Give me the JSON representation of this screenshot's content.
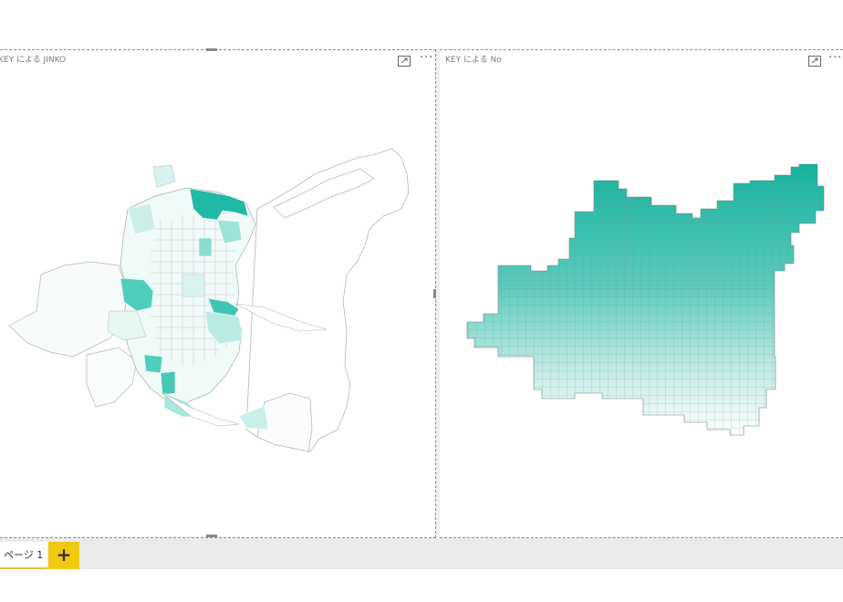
{
  "visuals": {
    "left": {
      "title": "KEY による JINKO"
    },
    "right": {
      "title": "KEY による No"
    }
  },
  "tabs": {
    "page1": "ページ 1",
    "add": "+"
  },
  "icons": {
    "focus": "focus-mode-icon",
    "more": "more-options-icon"
  },
  "colors": {
    "accent": "#1fb9a6",
    "tab_add": "#f2c811",
    "light_fill": "#f3fbfa"
  }
}
